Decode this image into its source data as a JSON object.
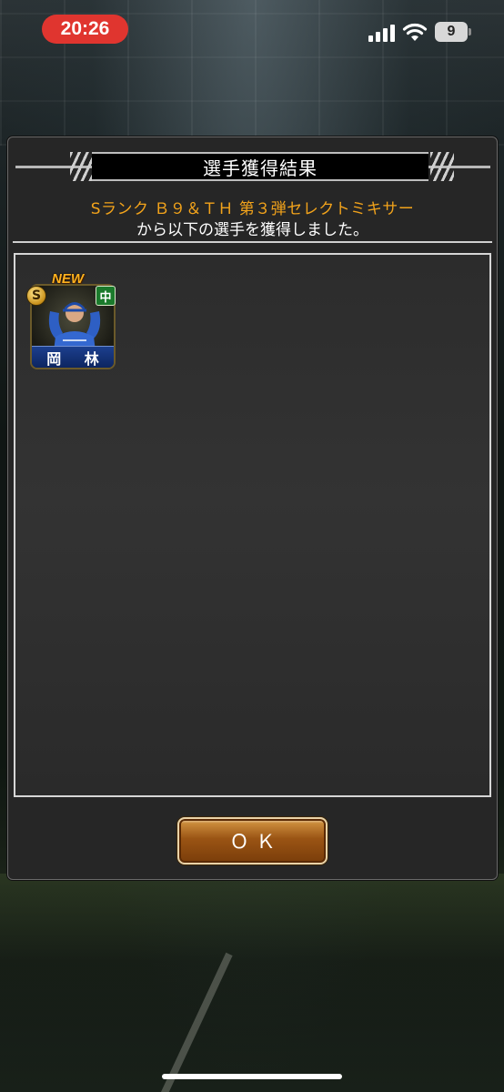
{
  "status_bar": {
    "time": "20:26",
    "battery_level": "9",
    "accent_color": "#e0352f",
    "icons": [
      "signal-icon",
      "wifi-icon",
      "battery-icon"
    ]
  },
  "dialog": {
    "title": "選手獲得結果",
    "subtitle": "Sランク Ｂ９＆ＴＨ 第３弾セレクトミキサー",
    "message": "から以下の選手を獲得しました。",
    "players": [
      {
        "name": "岡 林",
        "rank": "S",
        "new_label": "NEW",
        "team": "中"
      }
    ],
    "ok_label": "ＯＫ",
    "colors": {
      "subtitle": "#f2a31b",
      "ok_button": "#9a5414",
      "name_plate": "#1c3f8e",
      "team_badge": "#1b7a2c"
    }
  }
}
